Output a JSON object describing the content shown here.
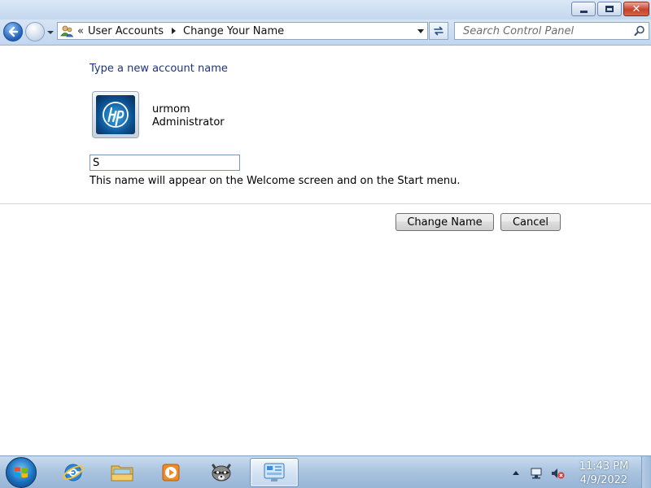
{
  "window": {
    "buttons": {
      "minimize": "minimize",
      "maximize": "maximize",
      "close": "close"
    }
  },
  "navbar": {
    "breadcrumb_overflow": "«",
    "breadcrumbs": [
      "User Accounts",
      "Change Your Name"
    ],
    "search_placeholder": "Search Control Panel"
  },
  "content": {
    "heading": "Type a new account name",
    "user": {
      "name": "urmom",
      "role": "Administrator"
    },
    "name_input_value": "S",
    "hint": "This name will appear on the Welcome screen and on the Start menu.",
    "buttons": {
      "change_name": "Change Name",
      "cancel": "Cancel"
    }
  },
  "taskbar": {
    "pinned": [
      "internet-explorer-icon",
      "windows-explorer-icon",
      "media-player-icon",
      "raccoon-app-icon",
      "control-panel-icon"
    ],
    "active_app": "control-panel",
    "clock": {
      "time": "11:43 PM",
      "date": "4/9/2022"
    }
  },
  "colors": {
    "heading": "#1e3287",
    "taskbar": "#a9c3df",
    "close_button": "#c7412a"
  }
}
